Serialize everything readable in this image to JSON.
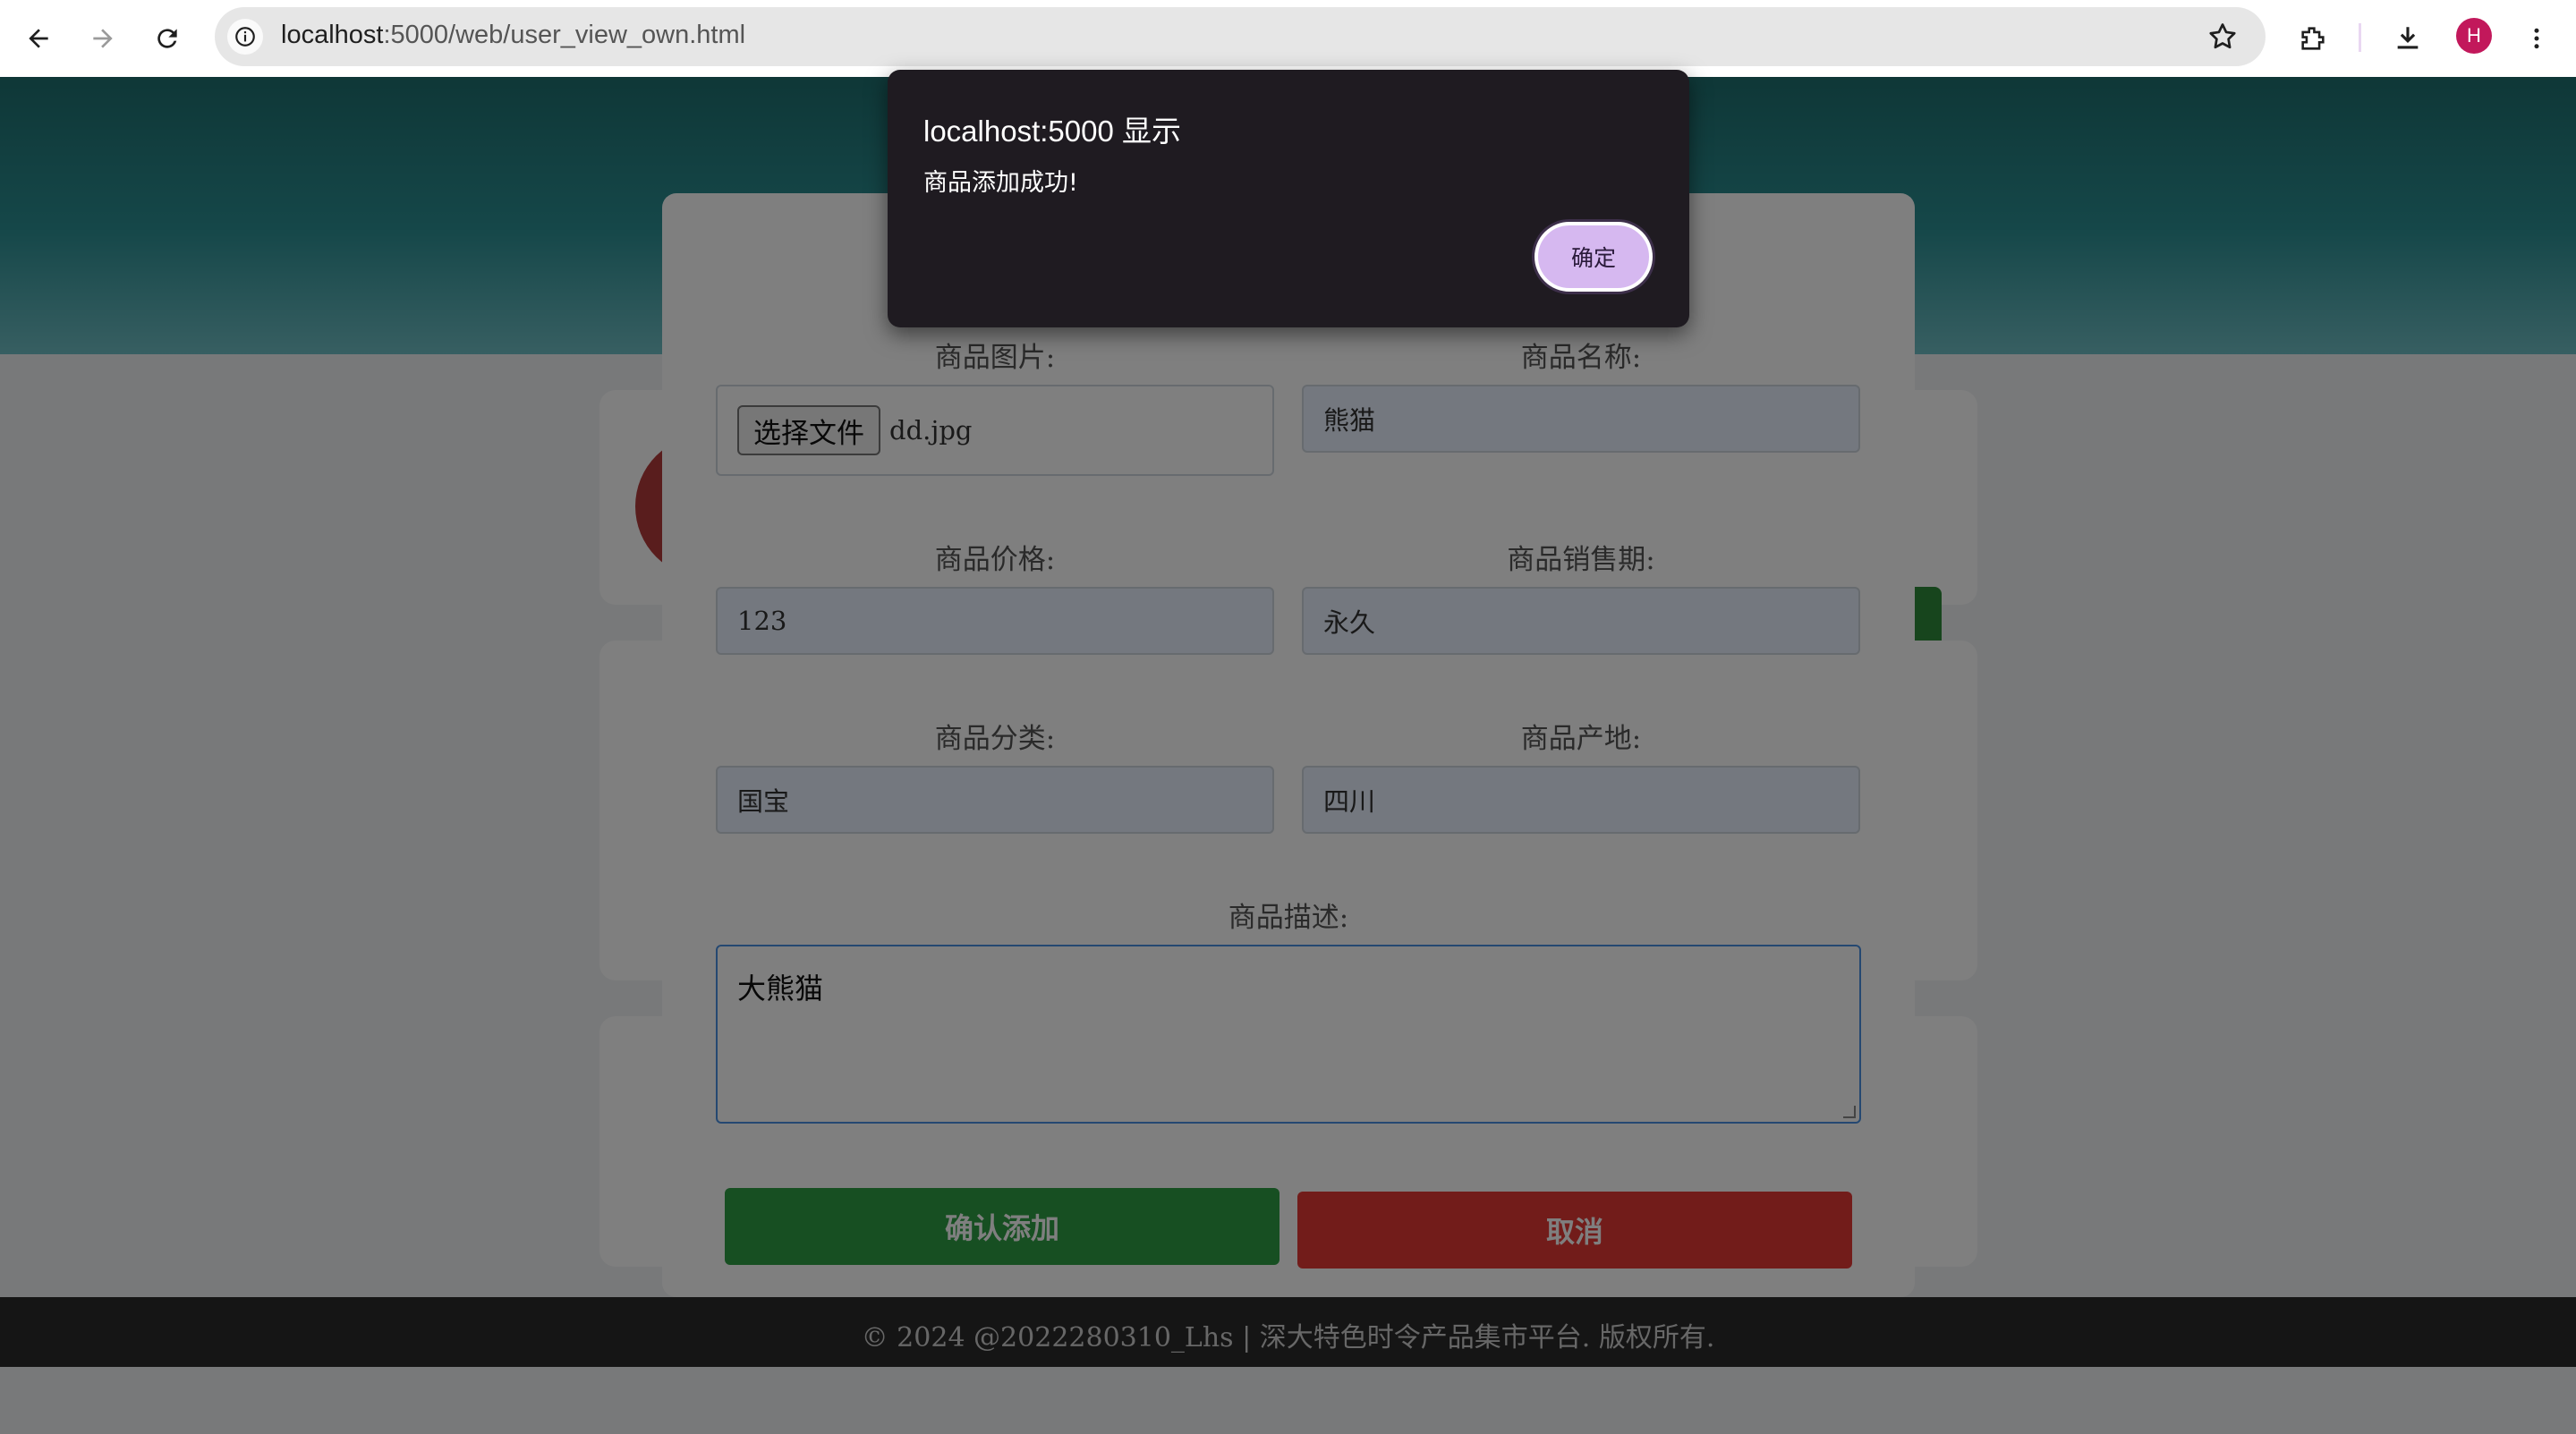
{
  "browser": {
    "url_host": "localhost",
    "url_rest": ":5000/web/user_view_own.html",
    "profile_initial": "H"
  },
  "form": {
    "image_label": "商品图片:",
    "file_button": "选择文件",
    "file_name": "dd.jpg",
    "name_label": "商品名称:",
    "name_value": "熊猫",
    "price_label": "商品价格:",
    "price_value": "123",
    "period_label": "商品销售期:",
    "period_value": "永久",
    "category_label": "商品分类:",
    "category_value": "国宝",
    "origin_label": "商品产地:",
    "origin_value": "四川",
    "desc_label": "商品描述:",
    "desc_value": "大熊猫",
    "confirm_button": "确认添加",
    "cancel_button": "取消"
  },
  "footer": {
    "text": "© 2024 @2022280310_Lhs | 深大特色时令产品集市平台. 版权所有."
  },
  "alert": {
    "title": "localhost:5000 显示",
    "message": "商品添加成功!",
    "ok_label": "确定"
  },
  "colors": {
    "confirm": "#2e9e44",
    "cancel": "#e53935",
    "alert_bg": "#1f1b21",
    "alert_button": "#d6b8f0"
  }
}
